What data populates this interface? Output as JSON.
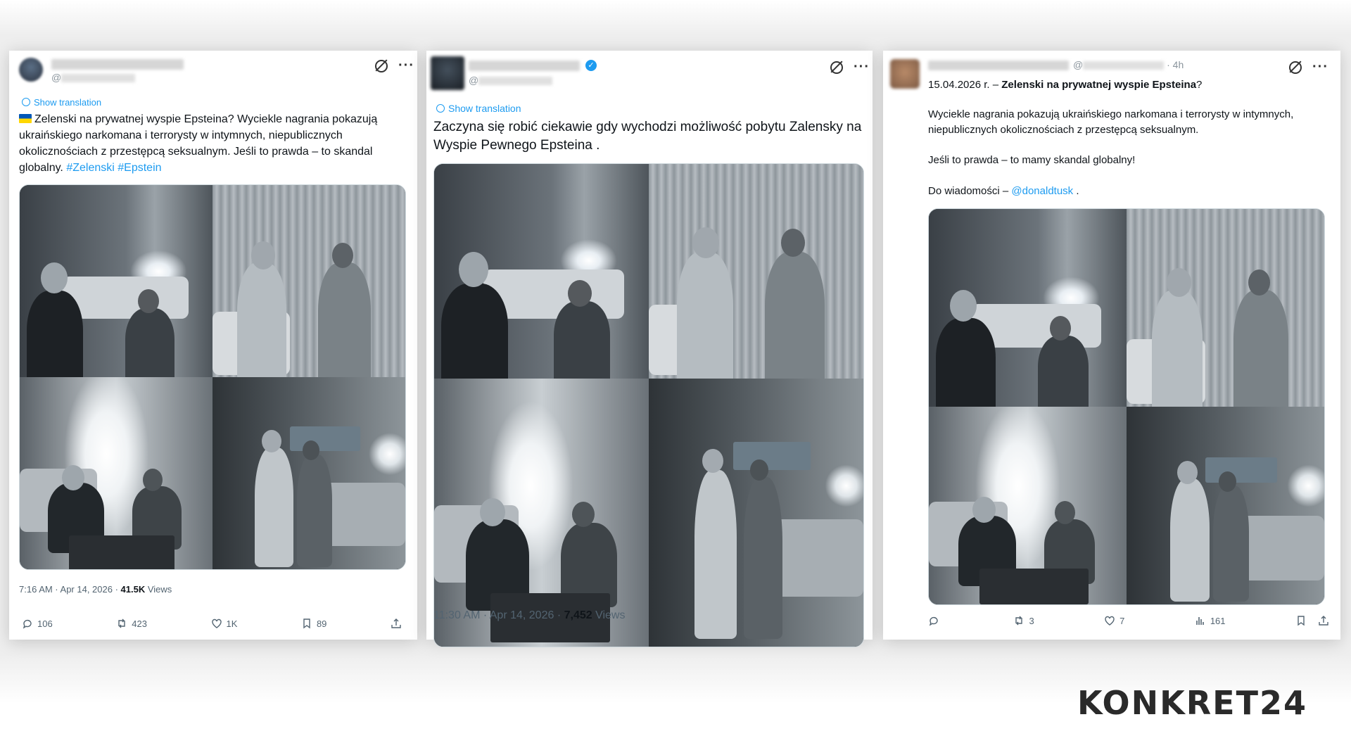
{
  "tweets": [
    {
      "text_prefix": "Zelenski na prywatnej wyspie Epsteina? Wyciekle nagrania pokazują ukraińskiego narkomana i terrorysty w intymnych, niepublicznych okolicznościach z przestępcą seksualnym. Jeśli to prawda – to skandal globalny. ",
      "hashtag1": "#Zelenski",
      "hashtag2": "#Epstein",
      "handle_prefix": "@",
      "show_translation": "Show translation",
      "time": "7:16 AM · Apr 14, 2026 · ",
      "views_count": "41.5K",
      "views_label": " Views",
      "replies": "106",
      "reposts": "423",
      "likes": "1K",
      "bookmarks": "89"
    },
    {
      "handle_prefix": "@",
      "show_translation": "Show translation",
      "text": "Zaczyna się robić ciekawie  gdy wychodzi możliwość pobytu Zalensky na Wyspie Pewnego Epsteina .",
      "time": "11:30 AM · Apr 14, 2026 · ",
      "views_count": "7,452",
      "views_label": " Views"
    },
    {
      "handle_prefix": "@",
      "age": "· 4h",
      "date_prefix": "15.04.2026 r. – ",
      "headline": "Zelenski na prywatnej wyspie Epsteina",
      "headline_end": "?",
      "para1": "Wyciekle nagrania pokazują ukraińskiego narkomana i terrorysty w intymnych, niepublicznych okolicznościach z przestępcą seksualnym.",
      "para2": "Jeśli to prawda – to mamy skandal globalny!",
      "para3_prefix": "Do wiadomości – ",
      "mention": "@donaldtusk",
      "para3_suffix": " .",
      "replies": "",
      "reposts": "3",
      "likes": "7",
      "views": "161"
    }
  ],
  "watermark": "KONKRET24",
  "colors": {
    "link": "#1d9bf0",
    "text": "#0f1419",
    "muted": "#536471"
  }
}
